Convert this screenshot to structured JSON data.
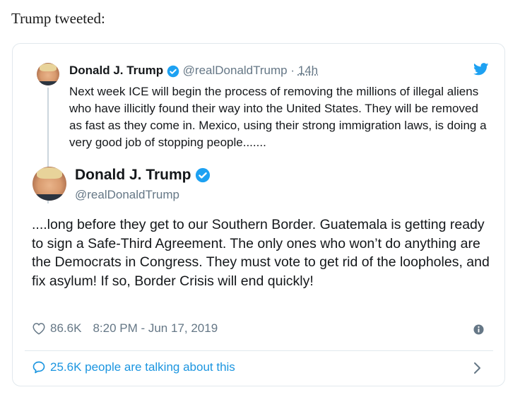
{
  "intro": "Trump tweeted:",
  "parent_tweet": {
    "name": "Donald J. Trump",
    "handle": "@realDonaldTrump",
    "separator": "·",
    "time": "14h",
    "text": "Next week ICE will begin the process of removing the millions of illegal aliens who have illicitly found their way into the United States. They will be removed as fast as they come in. Mexico, using their strong immigration laws, is doing a very good job of stopping people......."
  },
  "main_tweet": {
    "name": "Donald J. Trump",
    "handle": "@realDonaldTrump",
    "text": "....long before they get to our Southern Border. Guatemala is getting ready to sign a Safe-Third Agreement. The only ones who won’t do anything are the Democrats in Congress. They must vote to get rid of the loopholes, and fix asylum! If so, Border Crisis will end quickly!",
    "likes": "86.6K",
    "timestamp": "8:20 PM - Jun 17, 2019"
  },
  "footer": {
    "talking": "25.6K people are talking about this"
  },
  "colors": {
    "verified_blue": "#1da1f2",
    "link_blue": "#1b95e0",
    "muted_gray": "#657786",
    "border": "#e1e8ed"
  },
  "icons": [
    "verified-badge-icon",
    "twitter-bird-icon",
    "heart-icon",
    "info-icon",
    "speech-bubble-icon",
    "chevron-right-icon"
  ]
}
